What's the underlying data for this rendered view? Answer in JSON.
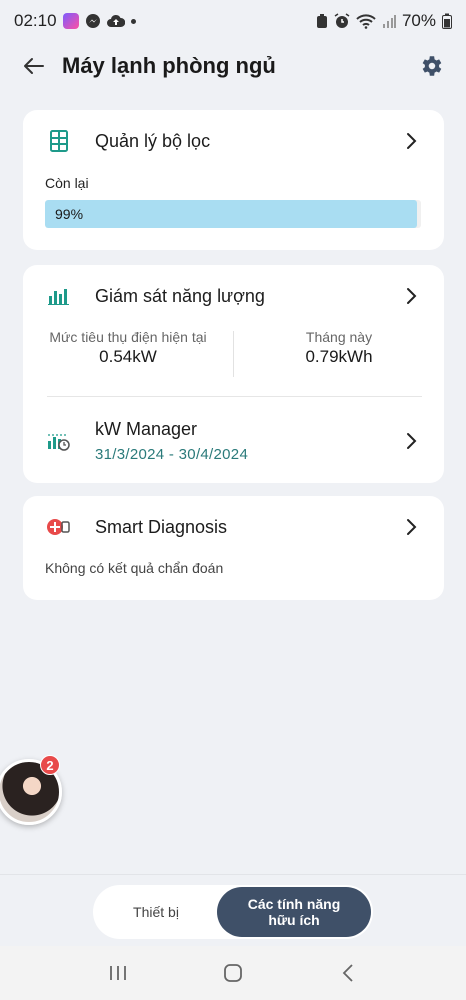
{
  "status_bar": {
    "time": "02:10",
    "battery": "70%"
  },
  "header": {
    "title": "Máy lạnh phòng ngủ"
  },
  "filter_card": {
    "title": "Quản lý bộ lọc",
    "remaining_label": "Còn lại",
    "remaining_text": "99%",
    "remaining_value": 0.99
  },
  "energy_card": {
    "title": "Giám sát năng lượng",
    "current_label": "Mức tiêu thụ điện hiện tại",
    "current_value": "0.54kW",
    "month_label": "Tháng này",
    "month_value": "0.79kWh",
    "kw_manager_title": "kW Manager",
    "kw_manager_dates": "31/3/2024 - 30/4/2024"
  },
  "diag_card": {
    "title": "Smart Diagnosis",
    "message": "Không có kết quả chẩn đoán"
  },
  "floating_avatar": {
    "badge_count": "2"
  },
  "bottom_tabs": {
    "devices": "Thiết bị",
    "features_line1": "Các tính năng",
    "features_line2": "hữu ích"
  },
  "colors": {
    "accent_teal": "#1e9a8a",
    "progress_fill": "#a9ddf2",
    "active_tab": "#3f5068",
    "diag_red": "#e84a4a"
  },
  "icons": {
    "filter": "grid-filter-icon",
    "energy": "bar-chart-icon",
    "kw_manager": "kw-manager-icon",
    "diagnosis": "smart-diagnosis-icon"
  }
}
